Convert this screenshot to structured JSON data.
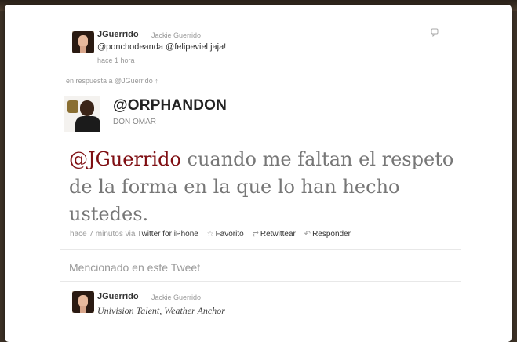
{
  "colors": {
    "page_bg": "#3b3025",
    "card_bg": "#ffffff",
    "mention": "#7f0e12",
    "meta": "#999999",
    "text": "#333333"
  },
  "reply_tweet": {
    "name": "JGuerrido",
    "fullname": "Jackie Guerrido",
    "mention1": "@ponchodeanda",
    "mention2": "@felipeviel",
    "text_end": "jaja!",
    "time": "hace 1 hora",
    "icon": "speech-bubble-icon"
  },
  "in_reply_to": {
    "label": "en respuesta a @JGuerrido ↑"
  },
  "main_tweet": {
    "name": "@ORPHANDON",
    "fullname": "DON OMAR",
    "mention": "@JGuerrido",
    "text": " cuando me faltan el respeto de la forma en la que lo han hecho ustedes.",
    "time": "hace 7 minutos",
    "via_label": "via",
    "via_app": "Twitter for iPhone",
    "favorite": "Favorito",
    "retweet": "Retwittear",
    "reply": "Responder"
  },
  "mentioned": {
    "heading": "Mencionado en este Tweet",
    "user": {
      "name": "JGuerrido",
      "fullname": "Jackie Guerrido",
      "bio": "Univision Talent, Weather Anchor"
    }
  }
}
